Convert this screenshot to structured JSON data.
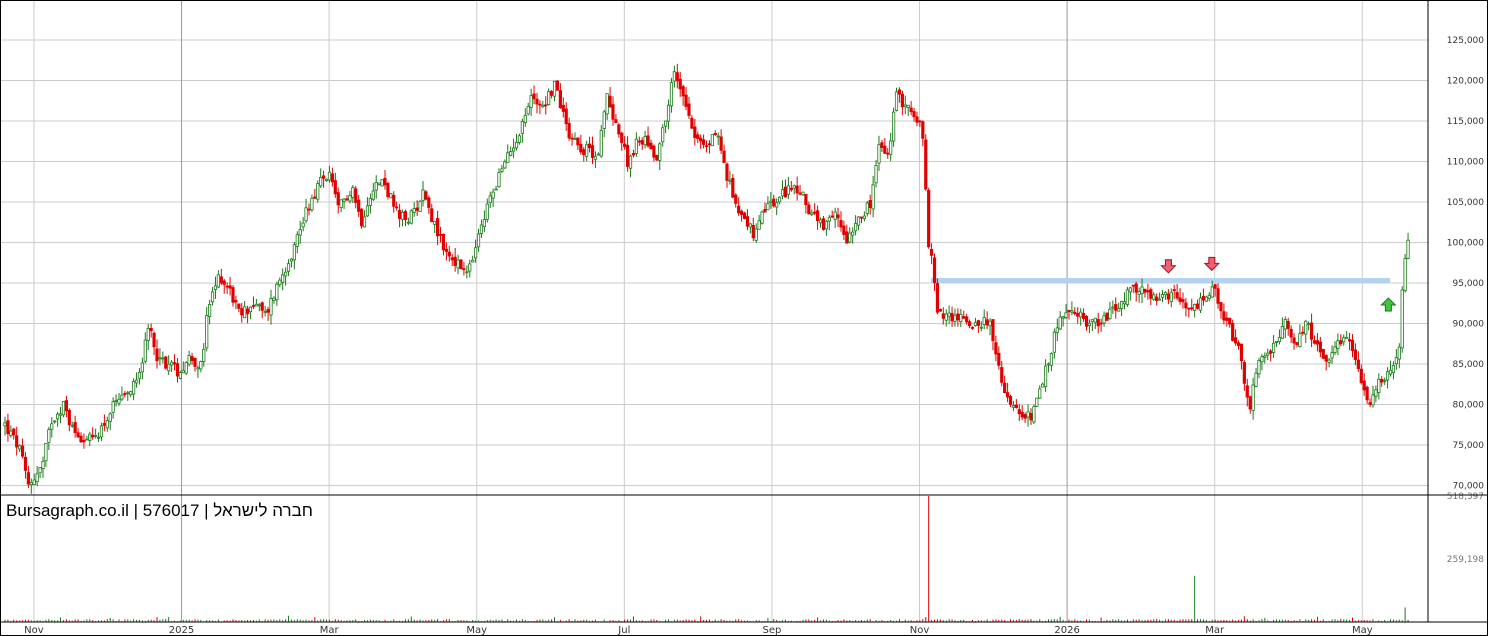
{
  "chart_data": {
    "type": "candlestick",
    "title": "Bursagraph.co.il | 576017 | חברה לישראל",
    "y_ticks": [
      "125,000",
      "120,000",
      "115,000",
      "110,000",
      "105,000",
      "100,000",
      "95,000",
      "90,000",
      "85,000",
      "80,000",
      "75,000",
      "70,000"
    ],
    "y_tick_values": [
      125000,
      120000,
      115000,
      110000,
      105000,
      100000,
      95000,
      90000,
      85000,
      80000,
      75000,
      70000
    ],
    "ylim": [
      69000,
      130000
    ],
    "volume_ticks": [
      "518,397",
      "259,198"
    ],
    "volume_tick_values": [
      518397,
      259198
    ],
    "volume_max": 518397,
    "x_months": [
      "Nov",
      "2025",
      "Mar",
      "May",
      "Jul",
      "Sep",
      "Nov",
      "2026",
      "Mar",
      "May"
    ],
    "x_month_positions": [
      0.5,
      3.05,
      5.6,
      8.15,
      10.7,
      13.25,
      15.8,
      18.35,
      20.9,
      23.45
    ],
    "time_span": 23.6,
    "resistance_level": 95300,
    "resistance_from": 16.0,
    "colors": {
      "up": "#1a7a1a",
      "down": "#e00000",
      "grid": "#cccccc",
      "resistance": "#b3d1f0",
      "arrow_down": "#f06070",
      "arrow_up": "#3cc83c"
    },
    "markers": [
      {
        "type": "arrow-down",
        "t": 20.1,
        "price": 97000
      },
      {
        "type": "arrow-down",
        "t": 20.85,
        "price": 97300
      },
      {
        "type": "arrow-up",
        "t": 23.9,
        "price": 92400
      }
    ],
    "close_path": [
      [
        0.0,
        77500
      ],
      [
        0.25,
        74500
      ],
      [
        0.4,
        70000
      ],
      [
        0.65,
        72500
      ],
      [
        0.8,
        78000
      ],
      [
        1.0,
        80000
      ],
      [
        1.2,
        76500
      ],
      [
        1.5,
        75500
      ],
      [
        1.7,
        77500
      ],
      [
        1.9,
        80000
      ],
      [
        2.1,
        80800
      ],
      [
        2.35,
        85000
      ],
      [
        2.5,
        89500
      ],
      [
        2.65,
        85500
      ],
      [
        2.85,
        85000
      ],
      [
        3.0,
        84000
      ],
      [
        3.2,
        86000
      ],
      [
        3.4,
        84500
      ],
      [
        3.5,
        91500
      ],
      [
        3.7,
        96000
      ],
      [
        3.9,
        94000
      ],
      [
        4.05,
        91000
      ],
      [
        4.3,
        92500
      ],
      [
        4.5,
        91000
      ],
      [
        4.75,
        95500
      ],
      [
        5.0,
        99500
      ],
      [
        5.2,
        104000
      ],
      [
        5.45,
        107500
      ],
      [
        5.6,
        108500
      ],
      [
        5.75,
        104000
      ],
      [
        6.0,
        107000
      ],
      [
        6.15,
        102500
      ],
      [
        6.35,
        107000
      ],
      [
        6.55,
        107500
      ],
      [
        6.8,
        103000
      ],
      [
        7.0,
        103000
      ],
      [
        7.25,
        106500
      ],
      [
        7.4,
        102500
      ],
      [
        7.6,
        99000
      ],
      [
        7.85,
        97000
      ],
      [
        8.0,
        96000
      ],
      [
        8.2,
        101000
      ],
      [
        8.4,
        106000
      ],
      [
        8.65,
        110000
      ],
      [
        8.9,
        114000
      ],
      [
        9.1,
        118000
      ],
      [
        9.3,
        117000
      ],
      [
        9.5,
        119500
      ],
      [
        9.75,
        113500
      ],
      [
        10.0,
        111500
      ],
      [
        10.25,
        111000
      ],
      [
        10.4,
        118000
      ],
      [
        10.55,
        115000
      ],
      [
        10.75,
        110000
      ],
      [
        10.9,
        112000
      ],
      [
        11.05,
        113000
      ],
      [
        11.25,
        110500
      ],
      [
        11.45,
        116500
      ],
      [
        11.55,
        121000
      ],
      [
        11.75,
        118000
      ],
      [
        11.9,
        113500
      ],
      [
        12.1,
        111500
      ],
      [
        12.3,
        114000
      ],
      [
        12.45,
        108500
      ],
      [
        12.65,
        104500
      ],
      [
        12.8,
        103000
      ],
      [
        12.95,
        100500
      ],
      [
        13.15,
        104500
      ],
      [
        13.35,
        105000
      ],
      [
        13.55,
        107000
      ],
      [
        13.75,
        106000
      ],
      [
        13.95,
        103500
      ],
      [
        14.15,
        101500
      ],
      [
        14.35,
        103500
      ],
      [
        14.55,
        100500
      ],
      [
        14.75,
        103500
      ],
      [
        14.95,
        104500
      ],
      [
        15.1,
        112000
      ],
      [
        15.25,
        110500
      ],
      [
        15.4,
        118000
      ],
      [
        15.6,
        117000
      ],
      [
        15.75,
        114500
      ],
      [
        15.85,
        114500
      ],
      [
        15.95,
        99500
      ],
      [
        16.05,
        96500
      ],
      [
        16.1,
        91000
      ],
      [
        16.3,
        91000
      ],
      [
        16.55,
        90500
      ],
      [
        16.75,
        90000
      ],
      [
        17.0,
        90500
      ],
      [
        17.15,
        84500
      ],
      [
        17.35,
        80500
      ],
      [
        17.55,
        78000
      ],
      [
        17.7,
        78500
      ],
      [
        17.85,
        80500
      ],
      [
        18.05,
        86000
      ],
      [
        18.2,
        90500
      ],
      [
        18.35,
        91000
      ],
      [
        18.55,
        91000
      ],
      [
        18.75,
        90000
      ],
      [
        18.95,
        90500
      ],
      [
        19.15,
        91500
      ],
      [
        19.4,
        93500
      ],
      [
        19.6,
        94500
      ],
      [
        19.8,
        93000
      ],
      [
        20.0,
        93000
      ],
      [
        20.2,
        93500
      ],
      [
        20.4,
        91500
      ],
      [
        20.6,
        92000
      ],
      [
        20.75,
        93500
      ],
      [
        20.9,
        94000
      ],
      [
        21.0,
        91000
      ],
      [
        21.15,
        89500
      ],
      [
        21.3,
        87000
      ],
      [
        21.5,
        79500
      ],
      [
        21.65,
        85000
      ],
      [
        21.8,
        86500
      ],
      [
        21.95,
        87000
      ],
      [
        22.1,
        90000
      ],
      [
        22.3,
        87500
      ],
      [
        22.45,
        90000
      ],
      [
        22.65,
        88000
      ],
      [
        22.85,
        84500
      ],
      [
        23.05,
        87500
      ],
      [
        23.25,
        88000
      ],
      [
        23.45,
        82000
      ],
      [
        23.6,
        80500
      ],
      [
        23.75,
        83000
      ],
      [
        23.95,
        84500
      ],
      [
        24.1,
        86500
      ],
      [
        24.15,
        95500
      ],
      [
        24.25,
        100500
      ]
    ]
  }
}
